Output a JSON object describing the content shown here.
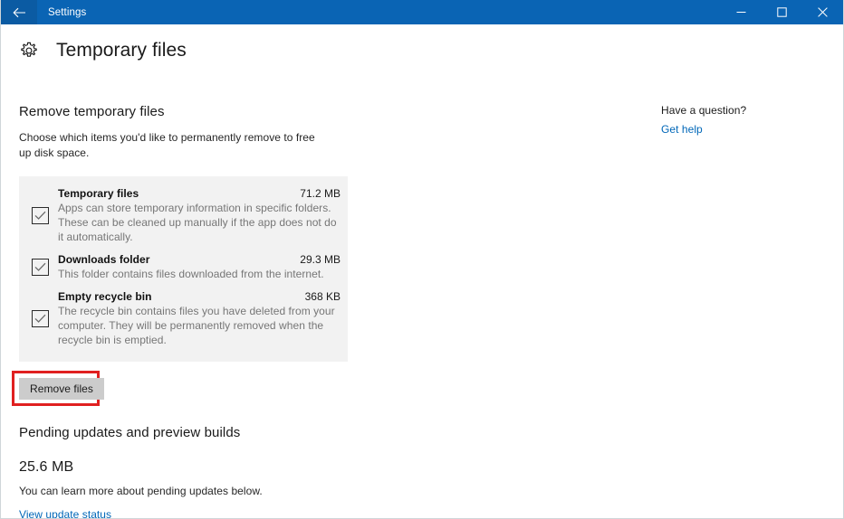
{
  "window": {
    "title": "Settings",
    "back_icon": "back-arrow-icon",
    "controls": {
      "minimize": "minimize-icon",
      "maximize": "maximize-icon",
      "close": "close-icon"
    },
    "titlebar_color": "#0a64b4",
    "back_button_color": "#0b5ba3"
  },
  "header": {
    "icon": "gear-icon",
    "title": "Temporary files"
  },
  "remove_section": {
    "heading": "Remove temporary files",
    "description": "Choose which items you'd like to permanently remove to free up disk space.",
    "items": [
      {
        "name": "Temporary files",
        "size": "71.2 MB",
        "description": "Apps can store temporary information in specific folders. These can be cleaned up manually if the app does not do it automatically.",
        "checked": true,
        "checkbox_icon": "checkmark-icon"
      },
      {
        "name": "Downloads folder",
        "size": "29.3 MB",
        "description": "This folder contains files downloaded from the internet.",
        "checked": true,
        "checkbox_icon": "checkmark-icon"
      },
      {
        "name": "Empty recycle bin",
        "size": "368 KB",
        "description": "The recycle bin contains files you have deleted from your computer. They will be permanently removed when the recycle bin is emptied.",
        "checked": true,
        "checkbox_icon": "checkmark-icon"
      }
    ],
    "remove_button_label": "Remove files",
    "annotation_color": "#e02020"
  },
  "pending_section": {
    "heading": "Pending updates and preview builds",
    "size": "25.6 MB",
    "description": "You can learn more about pending updates below.",
    "link_label": "View update status"
  },
  "aside": {
    "title": "Have a question?",
    "link_label": "Get help"
  },
  "colors": {
    "accent_link": "#0067b8",
    "panel_background": "#f2f2f2",
    "button_background": "#cccccc"
  }
}
